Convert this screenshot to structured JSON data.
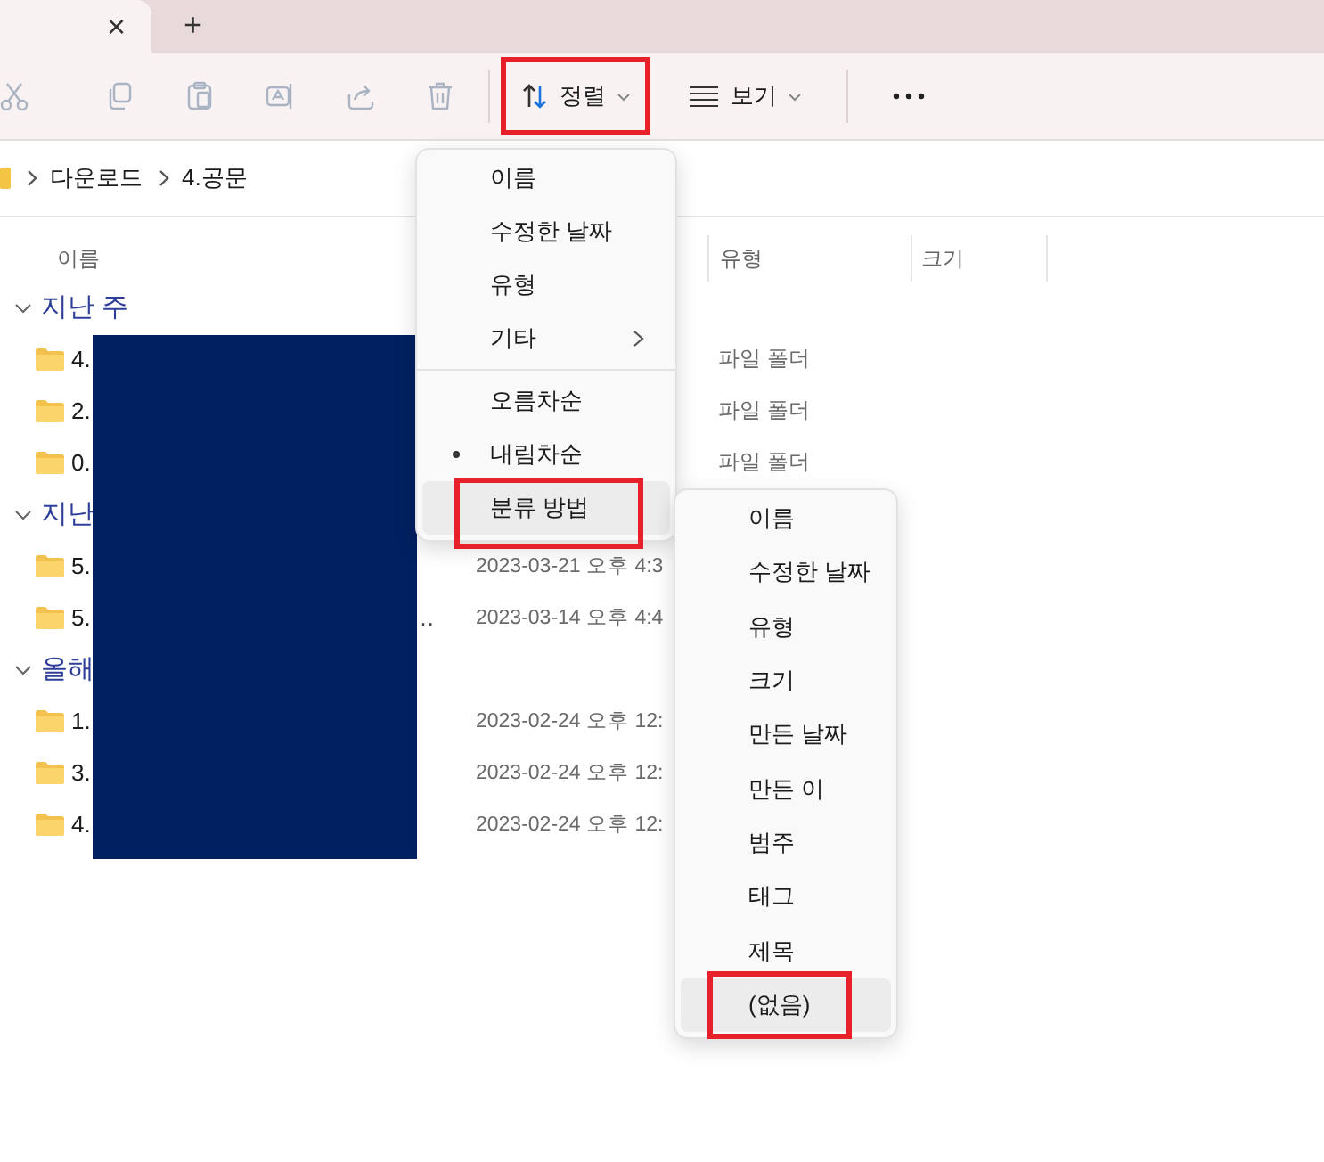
{
  "tabs": [
    {
      "close": "×",
      "selected": true
    }
  ],
  "new_tab": "+",
  "toolbar": {
    "actions": [
      {
        "kind": "cut",
        "disabled": true
      },
      {
        "kind": "copy",
        "disabled": true
      },
      {
        "kind": "paste",
        "disabled": true
      },
      {
        "kind": "rename",
        "disabled": true
      },
      {
        "kind": "share",
        "disabled": true
      },
      {
        "kind": "delete",
        "disabled": true
      }
    ],
    "sort": {
      "label": "정렬",
      "annotated": true
    },
    "view": {
      "label": "보기"
    }
  },
  "breadcrumb": [
    "다운로드",
    "4.공문"
  ],
  "columns": [
    {
      "label": "이름"
    },
    {
      "label": "유형"
    },
    {
      "label": "크기"
    }
  ],
  "groups": [
    {
      "label": "지난 주",
      "expanded": true,
      "rows": [
        {
          "name": "4.",
          "type": "파일 폴더"
        },
        {
          "name": "2.",
          "type": "파일 폴더"
        },
        {
          "name": "0.",
          "type": "파일 폴더"
        }
      ]
    },
    {
      "label": "지난",
      "expanded": true,
      "rows": [
        {
          "name": "5.",
          "date": "2023-03-21 오후 4:3"
        },
        {
          "name": "5.",
          "name_tail": "…",
          "date": "2023-03-14 오후 4:4"
        }
      ]
    },
    {
      "label": "올해",
      "expanded": true,
      "rows": [
        {
          "name": "1.",
          "date": "2023-02-24 오후 12:"
        },
        {
          "name": "3.",
          "date": "2023-02-24 오후 12:"
        },
        {
          "name": "4.",
          "date": "2023-02-24 오후 12:"
        }
      ]
    }
  ],
  "redacted": true,
  "sort_menu": {
    "items": [
      {
        "kind": "item",
        "label": "이름",
        "selected": false,
        "hovered": false,
        "annotated": false
      },
      {
        "kind": "item",
        "label": "수정한 날짜",
        "selected": false,
        "hovered": false,
        "annotated": false
      },
      {
        "kind": "item",
        "label": "유형",
        "selected": false,
        "hovered": false,
        "annotated": false
      },
      {
        "kind": "submenu",
        "label": "기타",
        "selected": false,
        "hovered": false,
        "annotated": false
      },
      {
        "kind": "divider"
      },
      {
        "kind": "item",
        "label": "오름차순",
        "selected": false,
        "hovered": false,
        "annotated": false
      },
      {
        "kind": "item",
        "label": "내림차순",
        "selected": true,
        "hovered": false,
        "annotated": false
      },
      {
        "kind": "item",
        "label": "분류 방법",
        "selected": false,
        "hovered": true,
        "annotated": true
      }
    ]
  },
  "group_menu": {
    "items": [
      {
        "label": "이름",
        "hovered": false,
        "annotated": false
      },
      {
        "label": "수정한 날짜",
        "hovered": false,
        "annotated": false
      },
      {
        "label": "유형",
        "hovered": false,
        "annotated": false
      },
      {
        "label": "크기",
        "hovered": false,
        "annotated": false
      },
      {
        "label": "만든 날짜",
        "hovered": false,
        "annotated": false
      },
      {
        "label": "만든 이",
        "hovered": false,
        "annotated": false
      },
      {
        "label": "범주",
        "hovered": false,
        "annotated": false
      },
      {
        "label": "태그",
        "hovered": false,
        "annotated": false
      },
      {
        "label": "제목",
        "hovered": false,
        "annotated": false
      },
      {
        "label": "(없음)",
        "hovered": true,
        "annotated": true
      }
    ]
  }
}
